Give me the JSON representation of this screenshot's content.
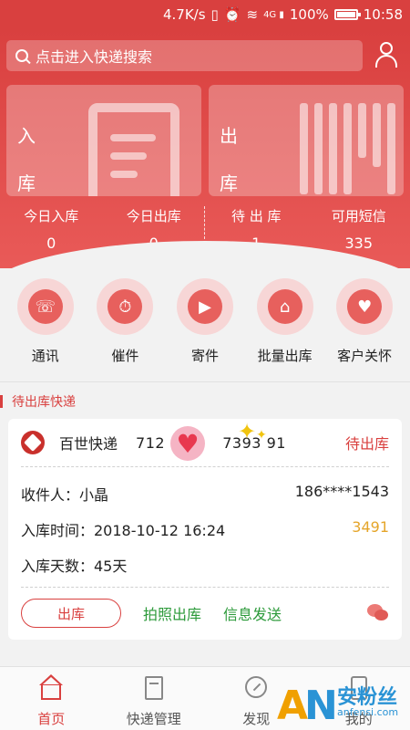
{
  "statusbar": {
    "speed": "4.7K/s",
    "signal_tag": "4G",
    "battery": "100%",
    "time": "10:58"
  },
  "search": {
    "placeholder": "点击进入快递搜索"
  },
  "cards": {
    "in": {
      "line1": "入",
      "line2": "库"
    },
    "out": {
      "line1": "出",
      "line2": "库"
    }
  },
  "stats": [
    {
      "title": "今日入库",
      "value": "0"
    },
    {
      "title": "今日出库",
      "value": "0"
    },
    {
      "title": "待 出 库",
      "value": "1"
    },
    {
      "title": "可用短信",
      "value": "335"
    }
  ],
  "actions": [
    {
      "label": "通讯",
      "icon": "phone-chat-icon"
    },
    {
      "label": "催件",
      "icon": "alarm-clock-icon"
    },
    {
      "label": "寄件",
      "icon": "truck-icon"
    },
    {
      "label": "批量出库",
      "icon": "warehouse-icon"
    },
    {
      "label": "客户关怀",
      "icon": "heart-hand-icon"
    }
  ],
  "section": {
    "title": "待出库快递"
  },
  "order": {
    "company": "百世快递",
    "tracking_part1": "712",
    "tracking_part2": "7393",
    "tracking_part3": "91",
    "status": "待出库",
    "recipient": "收件人：小晶",
    "phone": "186****1543",
    "time": "入库时间：2018-10-12 16:24",
    "code": "3491",
    "days": "入库天数：45天",
    "btn_out": "出库",
    "link_photo": "拍照出库",
    "link_msg": "信息发送"
  },
  "nav": [
    {
      "label": "首页",
      "active": true
    },
    {
      "label": "快递管理",
      "active": false
    },
    {
      "label": "发现",
      "active": false
    },
    {
      "label": "我的",
      "active": false
    }
  ],
  "watermark": {
    "a": "A",
    "n": "N",
    "cn": "安粉丝",
    "url": "anfensi.com"
  },
  "colors": {
    "brand": "#d9403f",
    "green": "#2c9a3a",
    "code": "#e5a52a"
  }
}
